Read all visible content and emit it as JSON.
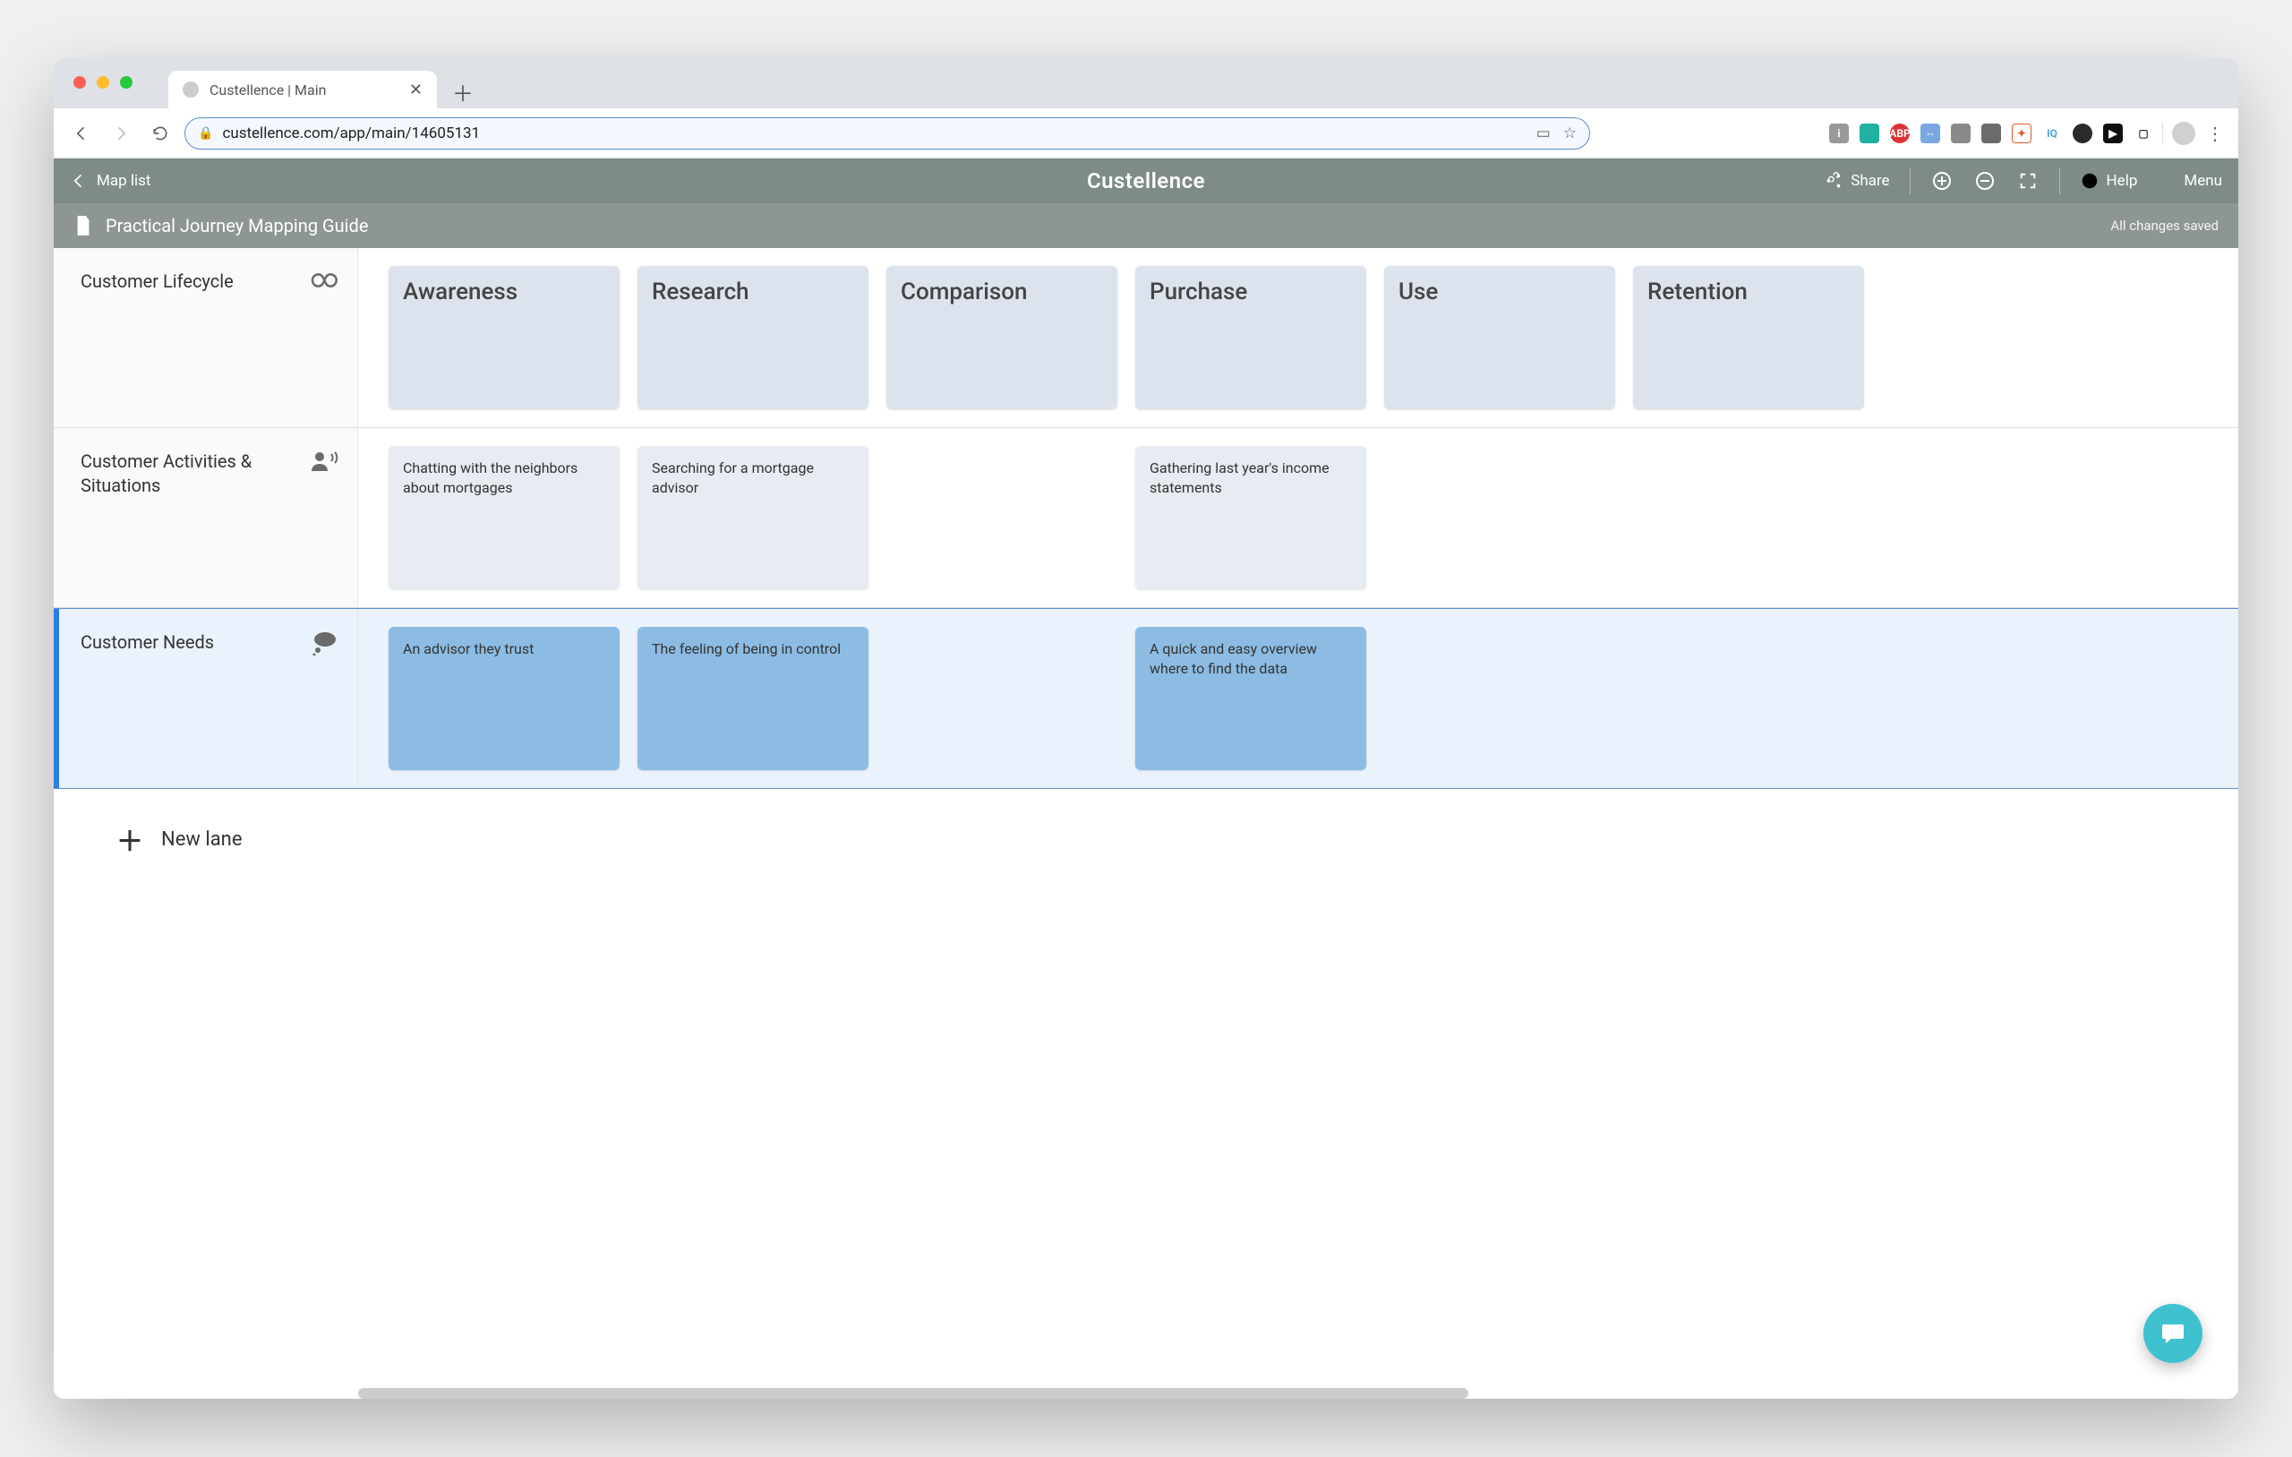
{
  "browser": {
    "tab_title": "Custellence | Main",
    "url": "custellence.com/app/main/14605131"
  },
  "appbar": {
    "map_list": "Map list",
    "brand": "Custellence",
    "share": "Share",
    "help": "Help",
    "menu": "Menu"
  },
  "docbar": {
    "title": "Practical Journey Mapping Guide",
    "status": "All changes saved"
  },
  "lanes": {
    "lifecycle": {
      "title": "Customer Lifecycle",
      "phases": [
        "Awareness",
        "Research",
        "Comparison",
        "Purchase",
        "Use",
        "Retention"
      ]
    },
    "activities": {
      "title": "Customer Activities & Situations",
      "cards": {
        "0": "Chatting with the neighbors about mortgages",
        "1": "Searching for a mortgage advisor",
        "3": "Gathering last year's income statements"
      }
    },
    "needs": {
      "title": "Customer Needs",
      "cards": {
        "0": "An advisor they trust",
        "1": "The feeling of being in control",
        "3": "A quick and easy overview where to find the data"
      }
    }
  },
  "new_lane": "New lane"
}
